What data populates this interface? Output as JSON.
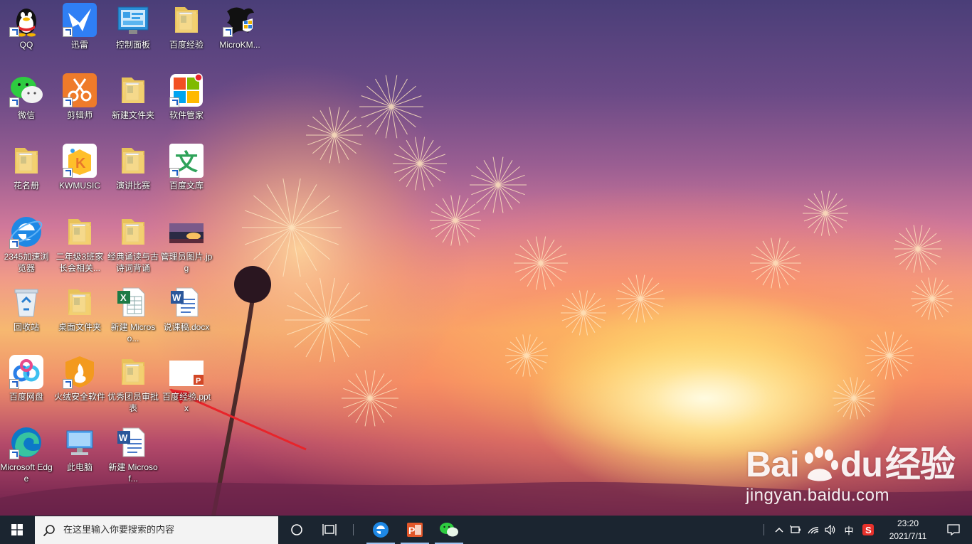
{
  "desktop": {
    "icons": [
      {
        "label": "QQ",
        "icon": "qq-penguin-icon"
      },
      {
        "label": "迅雷",
        "icon": "xunlei-bird-icon"
      },
      {
        "label": "控制面板",
        "icon": "control-panel-icon"
      },
      {
        "label": "百度经验",
        "icon": "folder-icon"
      },
      {
        "label": "MicroKM...",
        "icon": "dragon-shield-icon"
      },
      {
        "label": "微信",
        "icon": "wechat-icon"
      },
      {
        "label": "剪辑师",
        "icon": "scissors-icon"
      },
      {
        "label": "新建文件夹",
        "icon": "folder-icon"
      },
      {
        "label": "软件管家",
        "icon": "software-manager-icon"
      },
      {
        "label": "花名册",
        "icon": "folder-icon"
      },
      {
        "label": "KWMUSIC",
        "icon": "kwmusic-icon"
      },
      {
        "label": "演讲比赛",
        "icon": "folder-icon"
      },
      {
        "label": "百度文库",
        "icon": "baidu-wenku-icon"
      },
      {
        "label": "2345加速浏览器",
        "icon": "ie-browser-icon"
      },
      {
        "label": "二年级3班家长会相关...",
        "icon": "folder-icon"
      },
      {
        "label": "经典诵读与古诗词背诵",
        "icon": "folder-icon"
      },
      {
        "label": "管理员图片.jpg",
        "icon": "image-file-icon"
      },
      {
        "label": "回收站",
        "icon": "recycle-bin-icon"
      },
      {
        "label": "桌面文件夹",
        "icon": "folder-icon"
      },
      {
        "label": "新建 Microso...",
        "icon": "excel-file-icon"
      },
      {
        "label": "说课稿.docx",
        "icon": "word-file-icon"
      },
      {
        "label": "百度网盘",
        "icon": "baidu-netdisk-icon"
      },
      {
        "label": "火绒安全软件",
        "icon": "huorong-icon"
      },
      {
        "label": "优秀团员审批表",
        "icon": "folder-icon"
      },
      {
        "label": "百度经验.pptx",
        "icon": "ppt-file-icon"
      },
      {
        "label": "Microsoft Edge",
        "icon": "edge-icon"
      },
      {
        "label": "此电脑",
        "icon": "this-pc-icon"
      },
      {
        "label": "新建 Microsof...",
        "icon": "word-file-icon"
      }
    ]
  },
  "watermark": {
    "brand": "Bai",
    "brand_tail": "du",
    "brand_cn": "经验",
    "url": "jingyan.baidu.com"
  },
  "taskbar": {
    "start_icon": "windows-logo-icon",
    "search_placeholder": "在这里输入你要搜索的内容",
    "pinned_apps": [
      "ie-browser-icon",
      "powerpoint-icon",
      "wechat-icon"
    ],
    "ime_label": "中",
    "time": "23:20",
    "date": "2021/7/11"
  },
  "colors": {
    "taskbar_bg": "#1b2530",
    "search_bg": "#f3f3f3",
    "arrow": "#e8242a"
  }
}
